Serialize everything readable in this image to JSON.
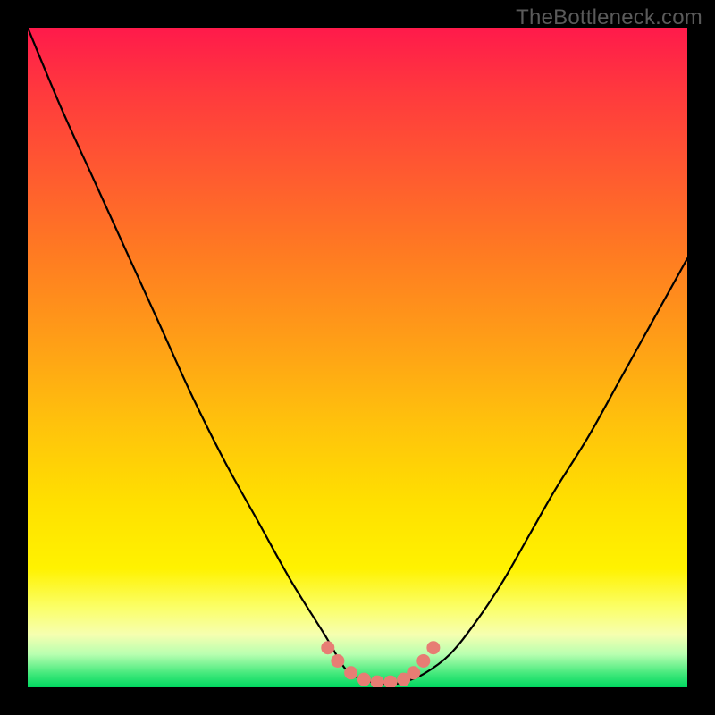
{
  "watermark": "TheBottleneck.com",
  "chart_data": {
    "type": "line",
    "title": "",
    "xlabel": "",
    "ylabel": "",
    "xlim": [
      0,
      100
    ],
    "ylim": [
      0,
      100
    ],
    "series": [
      {
        "name": "bottleneck-curve",
        "x": [
          0,
          5,
          10,
          15,
          20,
          25,
          30,
          35,
          40,
          45,
          48,
          50,
          52,
          55,
          57,
          60,
          64,
          68,
          72,
          76,
          80,
          85,
          90,
          95,
          100
        ],
        "values": [
          100,
          88,
          77,
          66,
          55,
          44,
          34,
          25,
          16,
          8,
          3,
          1.5,
          0.8,
          0.5,
          0.8,
          2,
          5,
          10,
          16,
          23,
          30,
          38,
          47,
          56,
          65
        ]
      }
    ],
    "markers": {
      "name": "highlight-dots",
      "color": "#e77d74",
      "points_x": [
        45.5,
        47.0,
        49.0,
        51.0,
        53.0,
        55.0,
        57.0,
        58.5,
        60.0,
        61.5
      ],
      "points_y": [
        6.0,
        4.0,
        2.2,
        1.2,
        0.8,
        0.8,
        1.2,
        2.2,
        4.0,
        6.0
      ]
    }
  }
}
